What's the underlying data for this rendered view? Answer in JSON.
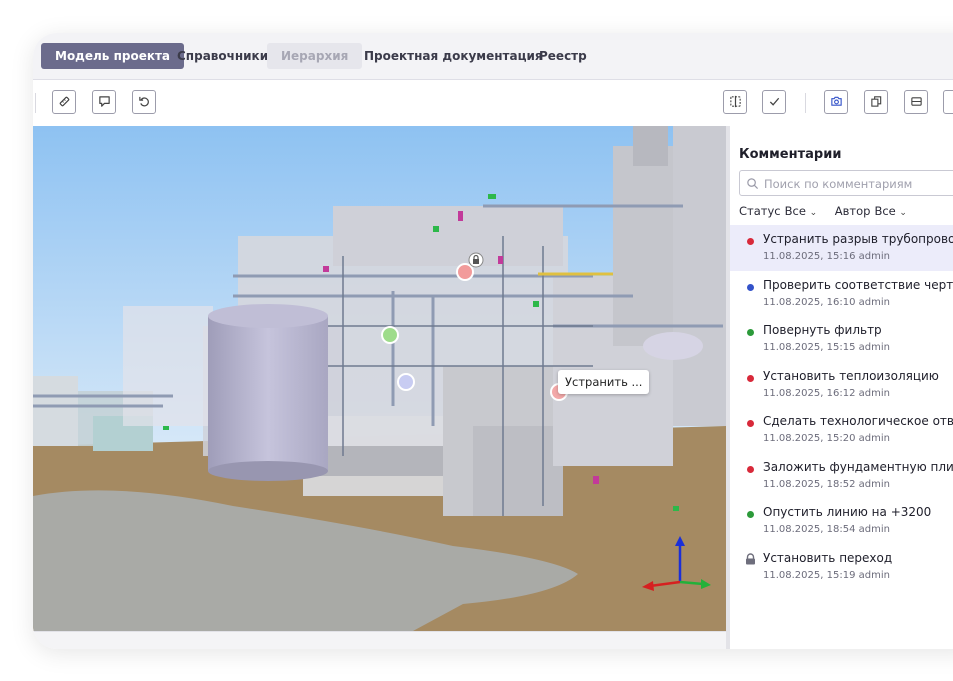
{
  "tabs": [
    {
      "label": "Модель проекта",
      "state": "active"
    },
    {
      "label": "Справочники",
      "state": "normal"
    },
    {
      "label": "Иерархия",
      "state": "disabled"
    },
    {
      "label": "Проектная документация",
      "state": "normal"
    },
    {
      "label": "Реестр",
      "state": "normal"
    }
  ],
  "toolbar": {
    "left_icons": [
      "ruler-icon",
      "comment-add-icon",
      "undo-icon"
    ],
    "right_icons": [
      "split-view-icon",
      "check-icon",
      "camera-icon",
      "copy-icon",
      "section-box-icon"
    ]
  },
  "viewport": {
    "callout": "Устранить ...",
    "markers": [
      {
        "status": "red"
      },
      {
        "status": "locked"
      },
      {
        "status": "green"
      },
      {
        "status": "blue"
      },
      {
        "status": "red"
      }
    ]
  },
  "comments": {
    "title": "Комментарии",
    "search_placeholder": "Поиск по комментариям",
    "filter_status_label": "Статус",
    "filter_status_value": "Все",
    "filter_author_label": "Автор",
    "filter_author_value": "Все",
    "items": [
      {
        "title": "Устранить разрыв трубопровода",
        "meta": "11.08.2025, 15:16  admin",
        "status": "red",
        "selected": true
      },
      {
        "title": "Проверить соответствие чертежа",
        "meta": "11.08.2025, 16:10  admin",
        "status": "blue"
      },
      {
        "title": "Повернуть фильтр",
        "meta": "11.08.2025, 15:15  admin",
        "status": "green"
      },
      {
        "title": "Установить теплоизоляцию",
        "meta": "11.08.2025, 16:12  admin",
        "status": "red"
      },
      {
        "title": "Сделать технологическое отверст",
        "meta": "11.08.2025, 15:20  admin",
        "status": "red"
      },
      {
        "title": "Заложить фундаментную плиту по",
        "meta": "11.08.2025, 18:52  admin",
        "status": "red"
      },
      {
        "title": "Опустить линию на +3200",
        "meta": "11.08.2025, 18:54  admin",
        "status": "green"
      },
      {
        "title": "Установить переход",
        "meta": "11.08.2025, 15:19  admin",
        "status": "locked"
      }
    ]
  },
  "colors": {
    "red": "#d8293a",
    "blue": "#3352c9",
    "green": "#2c9a3a",
    "locked": "#6e6e7c",
    "active_tab": "#6b6b8c",
    "selected_row": "#ececfa"
  }
}
